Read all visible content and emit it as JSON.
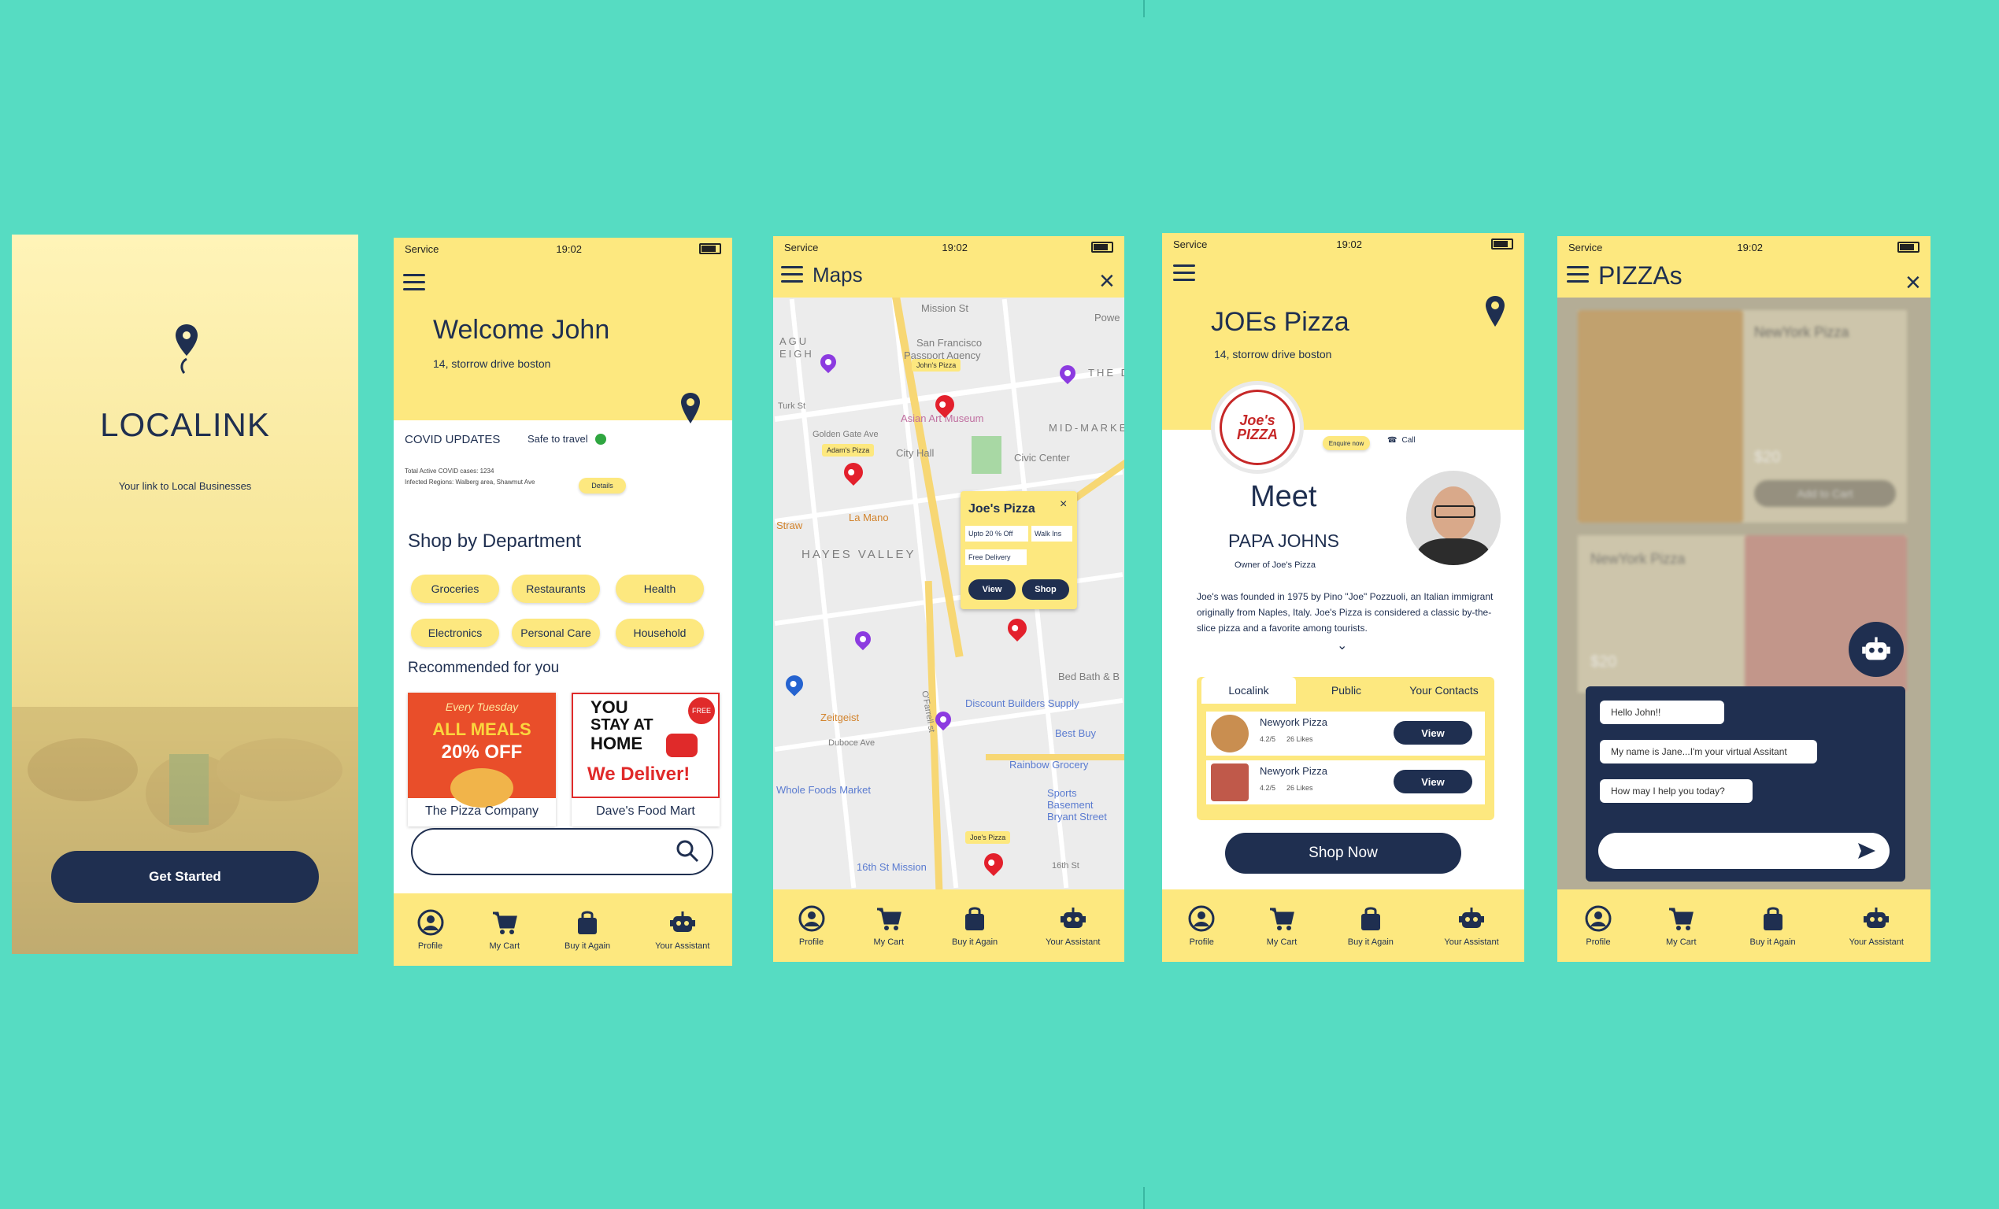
{
  "colors": {
    "background": "#56dcc2",
    "accent_yellow": "#fde87f",
    "navy": "#1f2f50",
    "red": "#e3202c"
  },
  "status": {
    "carrier": "Service",
    "time": "19:02"
  },
  "nav": [
    "Profile",
    "My Cart",
    "Buy it Again",
    "Your Assistant"
  ],
  "nav_icons": [
    "profile-icon",
    "cart-icon",
    "bag-icon",
    "robot-icon"
  ],
  "splash": {
    "title": "LOCALINK",
    "tagline": "Your link to Local Businesses",
    "cta": "Get Started"
  },
  "home": {
    "welcome": "Welcome John",
    "address": "14, storrow drive boston",
    "covid_title": "COVID UPDATES",
    "safe_travel": "Safe to travel",
    "covid_line1": "Total Active COVID cases: 1234",
    "covid_line2": "Infected Regions: Walberg area, Shawmut Ave",
    "details": "Details",
    "shop_by": "Shop by Department",
    "departments": [
      "Groceries",
      "Restaurants",
      "Health",
      "Electronics",
      "Personal Care",
      "Household"
    ],
    "recommended": "Recommended for you",
    "rec1": {
      "name": "The Pizza Company",
      "line1": "Every Tuesday",
      "line2": "ALL MEALS",
      "line3": "20% OFF"
    },
    "rec2": {
      "name": "Dave's Food Mart",
      "line1": "YOU",
      "line2": "STAY AT",
      "line3": "HOME",
      "line4": "We Deliver!",
      "badge": "FREE"
    }
  },
  "maps": {
    "title": "Maps",
    "labels": [
      "San Francisco",
      "Passport Agency",
      "Asian Art Museum",
      "City Hall",
      "Civic Center",
      "HAYES VALLEY",
      "Golden Gate Ave",
      "Turk St",
      "Straw",
      "Zeitgeist",
      "Duboce Ave",
      "Discount Builders Supply",
      "Best Buy",
      "Rainbow Grocery",
      "Whole Foods Market",
      "Sports Basement Bryant Street",
      "16th St Mission",
      "Bed Bath & B",
      "MID-MARKET",
      "THE DIST",
      "Powe",
      "O'Farrell st",
      "16th St",
      "Mission St",
      "La Mano"
    ],
    "pin_tags": [
      "John's Pizza",
      "Adam's Pizza",
      "Joe's Pizza"
    ],
    "popup": {
      "name": "Joe's Pizza",
      "offer": "Upto 20 % Off",
      "walkin": "Walk Ins",
      "delivery": "Free Delivery",
      "view": "View",
      "shop": "Shop"
    }
  },
  "joes": {
    "title": "JOEs Pizza",
    "address": "14, storrow drive boston",
    "logo": "Joe's PIZZA",
    "enquire": "Enquire now",
    "call": "Call",
    "meet": "Meet",
    "owner_name": "PAPA JOHNS",
    "owner_role": "Owner of Joe's Pizza",
    "description": "Joe's was founded in 1975 by Pino \"Joe\" Pozzuoli, an Italian immigrant originally from Naples, Italy. Joe's Pizza is considered a classic by-the-slice pizza and a favorite among tourists.",
    "tabs": [
      "Localink",
      "Public",
      "Your Contacts"
    ],
    "items": [
      {
        "name": "Newyork Pizza",
        "rating": "4.2/5",
        "likes": "26 Likes",
        "action": "View"
      },
      {
        "name": "Newyork Pizza",
        "rating": "4.2/5",
        "likes": "26 Likes",
        "action": "View"
      }
    ],
    "shop_now": "Shop Now"
  },
  "pizzas": {
    "title": "PIZZAs",
    "card1": {
      "name": "NewYork Pizza",
      "price": "$20",
      "add": "Add to Cart"
    },
    "card2": {
      "name": "NewYork Pizza",
      "price": "$20"
    },
    "chat": [
      "Hello John!!",
      "My name is Jane...I'm your virtual Assitant",
      "How may I help you today?"
    ]
  }
}
